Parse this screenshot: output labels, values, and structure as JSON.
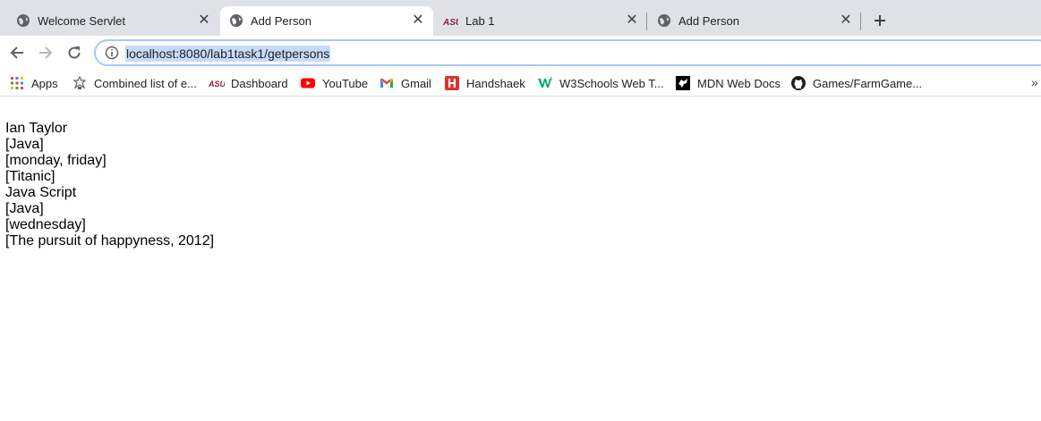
{
  "tabs": [
    {
      "title": "Welcome Servlet",
      "icon": "globe-icon",
      "active": false
    },
    {
      "title": "Add Person",
      "icon": "globe-icon",
      "active": true
    },
    {
      "title": "Lab 1",
      "icon": "asu-logo-icon",
      "active": false
    },
    {
      "title": "Add Person",
      "icon": "globe-icon",
      "active": false
    }
  ],
  "toolbar": {
    "url": "localhost:8080/lab1task1/getpersons"
  },
  "bookmarks": [
    {
      "label": "Apps",
      "icon": "apps-grid-icon"
    },
    {
      "label": "Combined list of e...",
      "icon": "combined-list-icon"
    },
    {
      "label": "Dashboard",
      "icon": "asu-logo-icon"
    },
    {
      "label": "YouTube",
      "icon": "youtube-icon"
    },
    {
      "label": "Gmail",
      "icon": "gmail-icon"
    },
    {
      "label": "Handshaek",
      "icon": "handshake-icon"
    },
    {
      "label": "W3Schools Web T...",
      "icon": "w3schools-icon"
    },
    {
      "label": "MDN Web Docs",
      "icon": "mdn-icon"
    },
    {
      "label": "Games/FarmGame...",
      "icon": "github-icon"
    }
  ],
  "content": {
    "lines": [
      "Ian Taylor",
      "[Java]",
      "[monday, friday]",
      "[Titanic]",
      "Java Script",
      "[Java]",
      "[wednesday]",
      "[The pursuit of happyness, 2012]"
    ]
  },
  "colors": {
    "tabstrip_bg": "#dee1e6",
    "url_selection": "#c6dbfa",
    "omnibox_border": "#a8c7fa",
    "asu_maroon": "#8c1d40",
    "youtube_red": "#ff0000",
    "handshake_red": "#e0312e",
    "w3schools_green": "#04aa6d"
  }
}
